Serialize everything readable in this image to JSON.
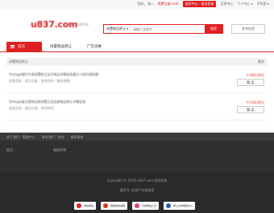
{
  "topbar": {
    "greeting": "您好，请入",
    "register": "免费注册.com",
    "seller_center": "卖家中心 · 退出登录",
    "buyer_center": "买家中心",
    "my_account": "个人中心 ▾",
    "mobile": "手机版 ▾"
  },
  "header": {
    "logo": "u837.com",
    "logo_sub": "游戏 · 交易平台",
    "search": {
      "category": "闲置物品转让",
      "placeholder": "请输入关键字",
      "button": "搜索"
    },
    "publish_label": "发布信息"
  },
  "nav": {
    "home": "首页",
    "items": [
      "闲置物品转让",
      "广告优惠"
    ]
  },
  "list": {
    "header_left": "闲置物品转让",
    "header_right": "更多",
    "rows": [
      {
        "title": "Vintage限时专享闲置转让宝贝商品详情信息展示介绍内容标题",
        "sub": "卖家信息 · 成交记录 · 发布时间 · 服务保障",
        "price": "¥ 400.00元",
        "button": "购 买"
      },
      {
        "title": "Vintage复古首饰全新闲置正品包邮商品转让详情信息",
        "sub": "卖家信息 · 成交记录 · 发布时间",
        "price": "¥ 248.00元",
        "button": "购 买"
      }
    ]
  },
  "footer": {
    "links_top": [
      "关于我们 · 帮助中心",
      "联系我们 · 合作",
      "商家服务"
    ],
    "links_mid": [
      "首页",
      "版权声明"
    ],
    "copyright1": "Copyright © 2018 u837.com 版权所有",
    "copyright2": "备案号: 信息产业部备案",
    "badges": [
      "诚信网站",
      "网络警察提醒",
      "可信网站认证",
      "网上交易保障中心"
    ]
  },
  "colors": {
    "accent": "#e02020",
    "footer": "#303030"
  }
}
